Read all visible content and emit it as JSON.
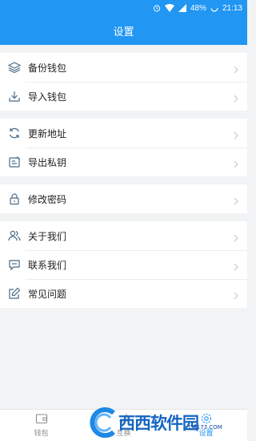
{
  "status": {
    "battery": "48%",
    "time": "21:13"
  },
  "header": {
    "title": "设置"
  },
  "groups": [
    {
      "items": [
        {
          "label": "备份钱包",
          "icon": "layers-icon"
        },
        {
          "label": "导入钱包",
          "icon": "download-icon"
        }
      ]
    },
    {
      "items": [
        {
          "label": "更新地址",
          "icon": "refresh-icon"
        },
        {
          "label": "导出私钥",
          "icon": "export-key-icon"
        }
      ]
    },
    {
      "items": [
        {
          "label": "修改密码",
          "icon": "lock-icon"
        }
      ]
    },
    {
      "items": [
        {
          "label": "关于我们",
          "icon": "people-icon"
        },
        {
          "label": "联系我们",
          "icon": "chat-icon"
        },
        {
          "label": "常见问题",
          "icon": "edit-icon"
        }
      ]
    }
  ],
  "nav": {
    "tabs": [
      {
        "label": "钱包"
      },
      {
        "label": "互换"
      },
      {
        "label": "设置"
      }
    ]
  },
  "watermark": {
    "text": "西西软件园",
    "sub": "CR173.COM"
  },
  "colors": {
    "primary": "#2196f3",
    "background": "#f2f3f5"
  }
}
